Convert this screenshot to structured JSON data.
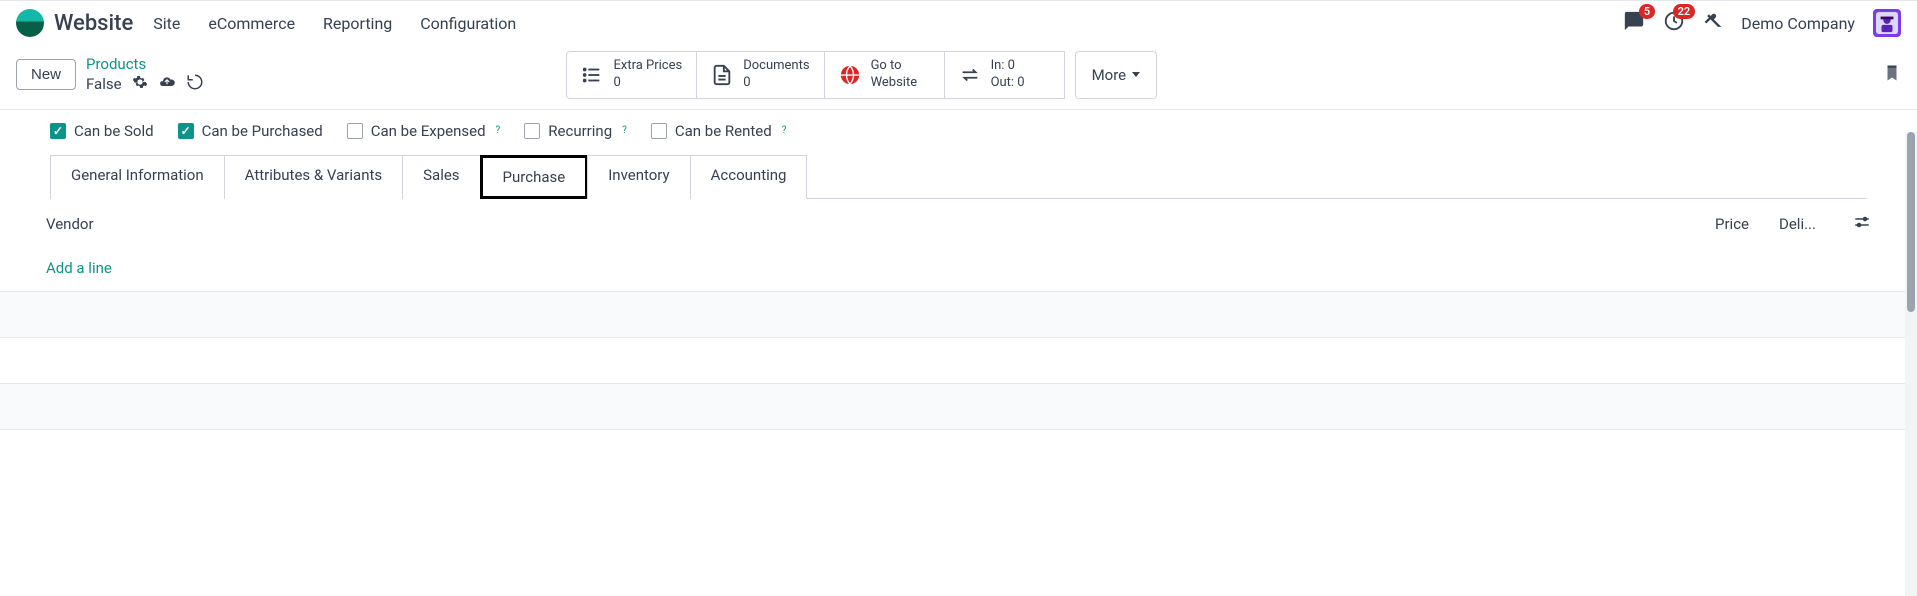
{
  "header": {
    "app_title": "Website",
    "menu": [
      "Site",
      "eCommerce",
      "Reporting",
      "Configuration"
    ],
    "messages_badge": "5",
    "activities_badge": "22",
    "company": "Demo Company"
  },
  "controlbar": {
    "new_label": "New",
    "breadcrumb_parent": "Products",
    "breadcrumb_current": "False",
    "stats": {
      "extra_prices_label": "Extra Prices",
      "extra_prices_value": "0",
      "documents_label": "Documents",
      "documents_value": "0",
      "go_to_label": "Go to",
      "website_label": "Website",
      "in_label": "In: 0",
      "out_label": "Out: 0",
      "more_label": "More"
    }
  },
  "checks": {
    "sold": "Can be Sold",
    "purchased": "Can be Purchased",
    "expensed": "Can be Expensed",
    "recurring": "Recurring",
    "rented": "Can be Rented"
  },
  "tabs": {
    "general": "General Information",
    "attrs": "Attributes & Variants",
    "sales": "Sales",
    "purchase": "Purchase",
    "inventory": "Inventory",
    "accounting": "Accounting"
  },
  "table": {
    "vendor": "Vendor",
    "price": "Price",
    "deli": "Deli...",
    "add_line": "Add a line"
  }
}
